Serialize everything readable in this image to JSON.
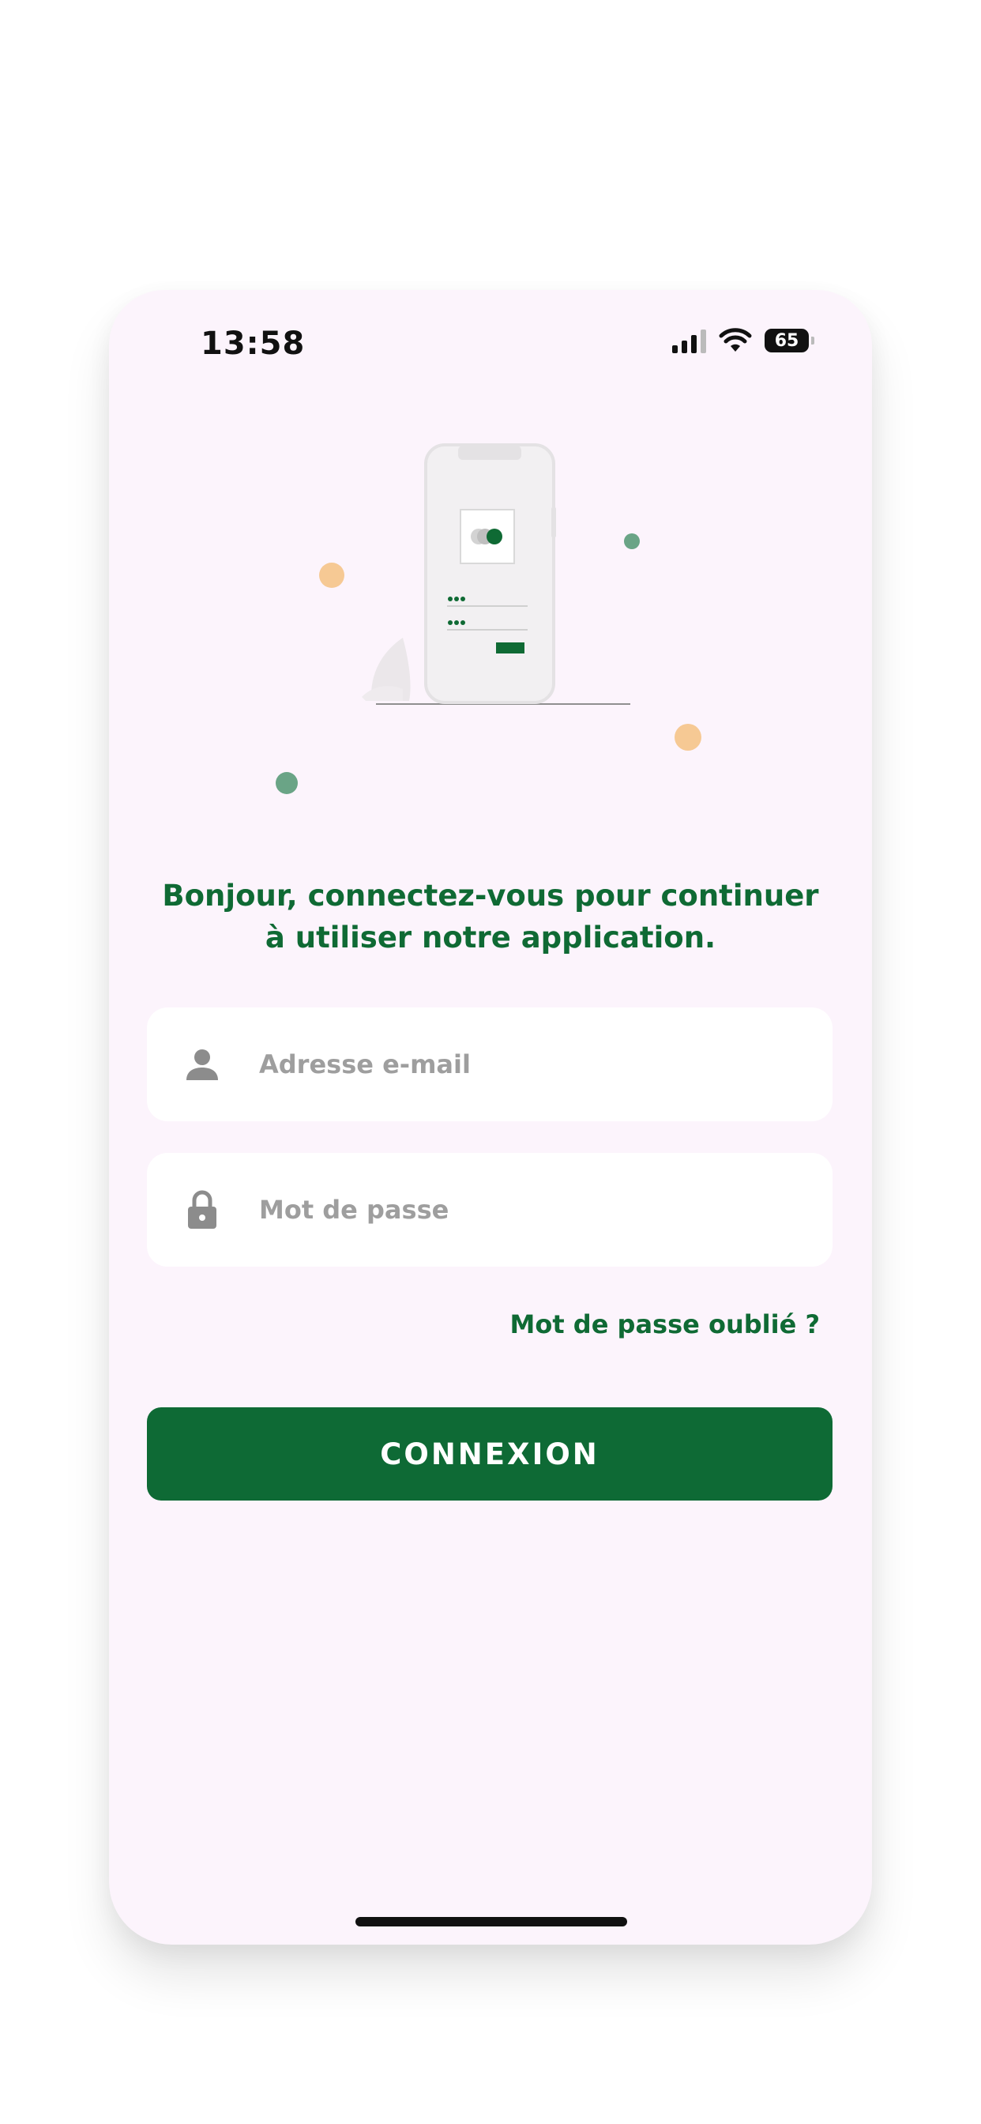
{
  "status_bar": {
    "time": "13:58",
    "battery": "65",
    "icons": [
      "signal-icon",
      "wifi-icon",
      "battery-icon"
    ]
  },
  "illustration": {
    "name": "phone-login-illustration",
    "colors": {
      "accent": "#0f6a34",
      "orange_dot": "#f6c994",
      "green_dot": "#6aa486"
    }
  },
  "login": {
    "headline_line1": "Bonjour, connectez-vous pour continuer",
    "headline_line2": "à utiliser notre application.",
    "email": {
      "placeholder": "Adresse e-mail",
      "value": "",
      "icon": "user-icon"
    },
    "password": {
      "placeholder": "Mot de passe",
      "value": "",
      "icon": "lock-icon"
    },
    "forgot_label": "Mot de passe oublié ?",
    "submit_label": "CONNEXION"
  },
  "theme": {
    "background": "#fcf4fc",
    "primary": "#0e6a35",
    "field_bg": "#ffffff",
    "placeholder": "#9e9e9e"
  }
}
